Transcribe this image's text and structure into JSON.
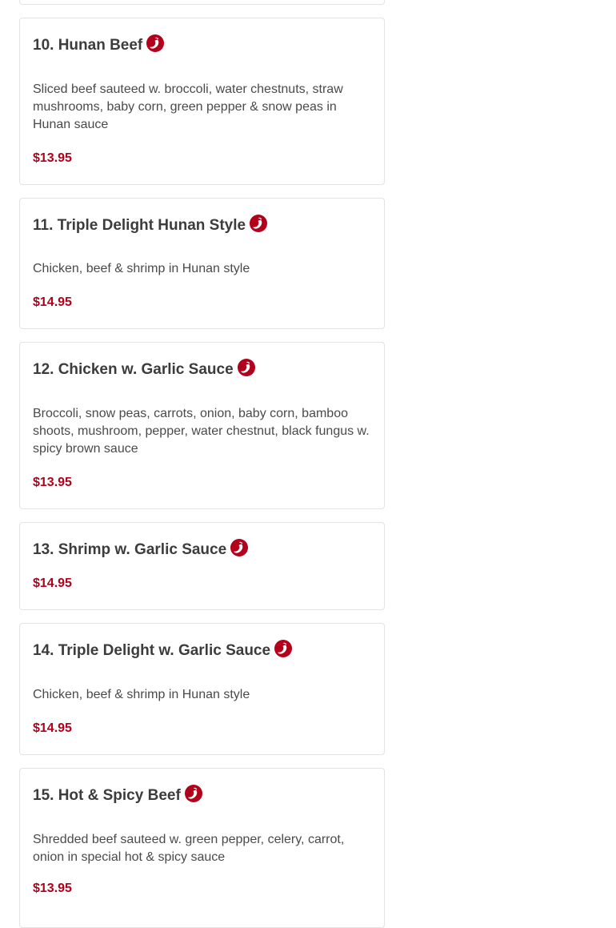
{
  "colors": {
    "price": "#b3001b",
    "spicy_icon": "#b3001b",
    "border": "#e3e3e3",
    "title": "#3c3c3c"
  },
  "items": [
    {
      "title": "10. Hunan Beef",
      "spicy": true,
      "icon": "spicy-pepper-icon",
      "description": "Sliced beef sauteed w. broccoli, water chestnuts, straw mushrooms, baby corn, green pepper & snow peas in Hunan sauce",
      "price": "$13.95"
    },
    {
      "title": "11. Triple Delight Hunan Style",
      "spicy": true,
      "icon": "spicy-pepper-icon",
      "description": "Chicken, beef & shrimp in Hunan style",
      "price": "$14.95"
    },
    {
      "title": "12. Chicken w. Garlic Sauce",
      "spicy": true,
      "icon": "spicy-pepper-icon",
      "description": "Broccoli, snow peas, carrots, onion, baby corn, bamboo shoots, mushroom, pepper, water chestnut, black fungus w. spicy brown sauce",
      "price": "$13.95"
    },
    {
      "title": "13. Shrimp w. Garlic Sauce",
      "spicy": true,
      "icon": "spicy-pepper-icon",
      "description": "",
      "price": "$14.95"
    },
    {
      "title": "14. Triple Delight w. Garlic Sauce",
      "spicy": true,
      "icon": "spicy-pepper-icon",
      "description": "Chicken, beef & shrimp in Hunan style",
      "price": "$14.95"
    },
    {
      "title": "15. Hot & Spicy Beef",
      "spicy": true,
      "icon": "spicy-pepper-icon",
      "description": "Shredded beef sauteed w. green pepper, celery, carrot, onion in special hot & spicy sauce",
      "price": "$13.95"
    }
  ]
}
